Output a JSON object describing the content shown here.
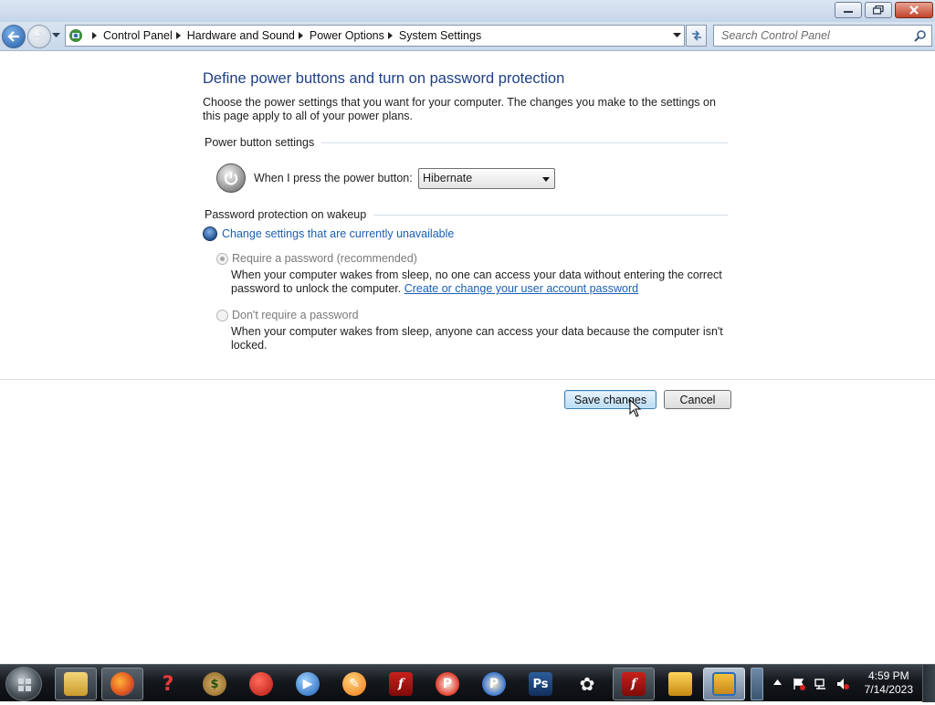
{
  "window": {
    "controls": [
      "minimize",
      "maximize",
      "close"
    ]
  },
  "address_bar": {
    "breadcrumbs": [
      "Control Panel",
      "Hardware and Sound",
      "Power Options",
      "System Settings"
    ]
  },
  "search": {
    "placeholder": "Search Control Panel"
  },
  "page": {
    "title": "Define power buttons and turn on password protection",
    "description": "Choose the power settings that you want for your computer. The changes you make to the settings on this page apply to all of your power plans.",
    "power_section": {
      "heading": "Power button settings",
      "label": "When I press the power button:",
      "selected_value": "Hibernate"
    },
    "password_section": {
      "heading": "Password protection on wakeup",
      "change_link": "Change settings that are currently unavailable",
      "options": [
        {
          "label": "Require a password (recommended)",
          "selected": true,
          "disabled": true,
          "description": "When your computer wakes from sleep, no one can access your data without entering the correct password to unlock the computer.",
          "link": "Create or change your user account password"
        },
        {
          "label": "Don't require a password",
          "selected": false,
          "disabled": true,
          "description": "When your computer wakes from sleep, anyone can access your data because the computer isn't locked."
        }
      ]
    },
    "buttons": {
      "save": "Save changes",
      "cancel": "Cancel"
    }
  },
  "taskbar": {
    "items": [
      "windows-explorer",
      "firefox",
      "quiz-app",
      "money-app",
      "red-game",
      "windows-media-player",
      "writing-app",
      "flash-player",
      "p-app-red",
      "p-app-blue",
      "photoshop",
      "flower-game",
      "flash-player-2",
      "gold-app",
      "control-panel-window"
    ],
    "clock_time": "4:59 PM",
    "clock_date": "7/14/2023"
  },
  "colors": {
    "title_blue": "#1e3f87",
    "link_blue": "#1a5fb4",
    "taskbar_dark": "#14181d"
  }
}
